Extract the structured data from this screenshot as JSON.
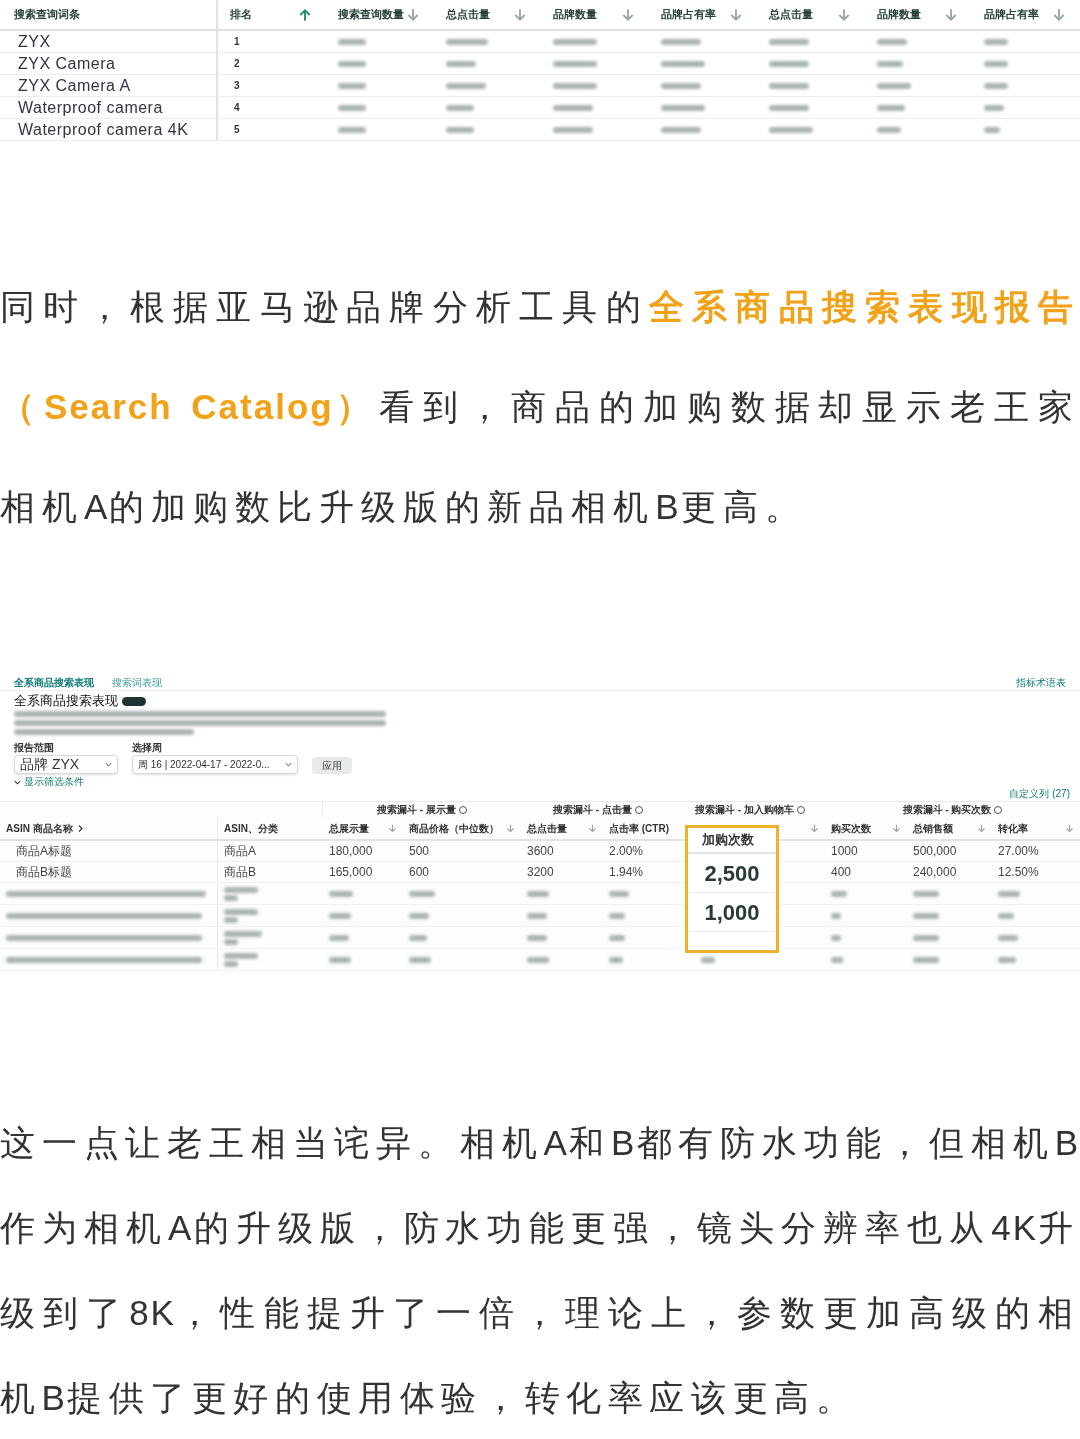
{
  "top_table": {
    "columns": [
      {
        "label": "搜索查询词条",
        "kind": "plain"
      },
      {
        "label": "排名",
        "kind": "asc"
      },
      {
        "label": "搜索查询数量",
        "kind": "desc"
      },
      {
        "label": "总点击量",
        "kind": "desc"
      },
      {
        "label": "品牌数量",
        "kind": "desc"
      },
      {
        "label": "品牌占有率",
        "kind": "desc"
      },
      {
        "label": "总点击量",
        "kind": "desc"
      },
      {
        "label": "品牌数量",
        "kind": "desc"
      },
      {
        "label": "品牌占有率",
        "kind": "desc"
      }
    ],
    "rows": [
      {
        "term": "ZYX",
        "rank": "1"
      },
      {
        "term": "ZYX Camera",
        "rank": "2"
      },
      {
        "term": "ZYX Camera A",
        "rank": "3"
      },
      {
        "term": "Waterproof camera",
        "rank": "4"
      },
      {
        "term": "Waterproof camera 4K",
        "rank": "5"
      }
    ]
  },
  "paragraphs": [
    [
      {
        "text": "同时，根据亚马逊品牌分析工具的",
        "highlight": false
      },
      {
        "text": "全系商品搜索表现报告（Search Catalog）",
        "highlight": true
      },
      {
        "text": "看到，商品的加购数据却显示老王家相机A的加购数比升级版的新品相机B更高。",
        "highlight": false
      }
    ],
    [
      {
        "text": "这一点让老王相当诧异。相机A和B都有防水功能，但相机B作为相机A的升级版，防水功能更强，镜头分辨率也从4K升级到了8K，性能提升了一倍，理论上，参数更加高级的相机B提供了更好的使用体验，转化率应该更高。",
        "highlight": false
      }
    ]
  ],
  "report": {
    "tabs": [
      {
        "label": "全系商品搜索表现",
        "selected": true
      },
      {
        "label": "搜索词表现",
        "selected": false
      }
    ],
    "glossary_link": "指标术语表",
    "title": "全系商品搜索表现",
    "filters": [
      {
        "label": "报告范围",
        "value": "品牌 ZYX",
        "kind": "large"
      },
      {
        "label": "选择周",
        "value": "周 16 | 2022-04-17 - 2022-0...",
        "kind": "small"
      }
    ],
    "apply_button": "应用",
    "show_filters_link": "显示筛选条件",
    "customize_link": "自定义列 (27)",
    "groups": [
      {
        "label": "搜索漏斗 - 展示量"
      },
      {
        "label": "搜索漏斗 - 点击量"
      },
      {
        "label": "搜索漏斗 - 加入购物车"
      },
      {
        "label": "搜索漏斗 - 购买次数"
      }
    ],
    "columns": [
      {
        "label": "ASIN 商品名称",
        "kind": "expand"
      },
      {
        "label": "ASIN、分类",
        "kind": "plain"
      },
      {
        "label": "总展示量",
        "kind": "desc"
      },
      {
        "label": "商品价格（中位数）",
        "kind": "desc"
      },
      {
        "label": "总点击量",
        "kind": "desc"
      },
      {
        "label": "点击率 (CTR)",
        "kind": "plain"
      },
      {
        "kind": "desc"
      },
      {
        "label": "购买次数",
        "kind": "desc"
      },
      {
        "label": "总销售额",
        "kind": "desc"
      },
      {
        "label": "转化率",
        "kind": "desc"
      }
    ],
    "rows": [
      {
        "cells": [
          "商品A标题",
          "商品A",
          "180,000",
          "500",
          "3600",
          "2.00%",
          "",
          "1000",
          "500,000",
          "27.00%"
        ]
      },
      {
        "cells": [
          "商品B标题",
          "商品B",
          "165,000",
          "600",
          "3200",
          "1.94%",
          "",
          "400",
          "240,000",
          "12.50%"
        ]
      }
    ],
    "highlight_box": {
      "heading": "加购次数",
      "values": [
        "2,500",
        "1,000"
      ]
    }
  }
}
